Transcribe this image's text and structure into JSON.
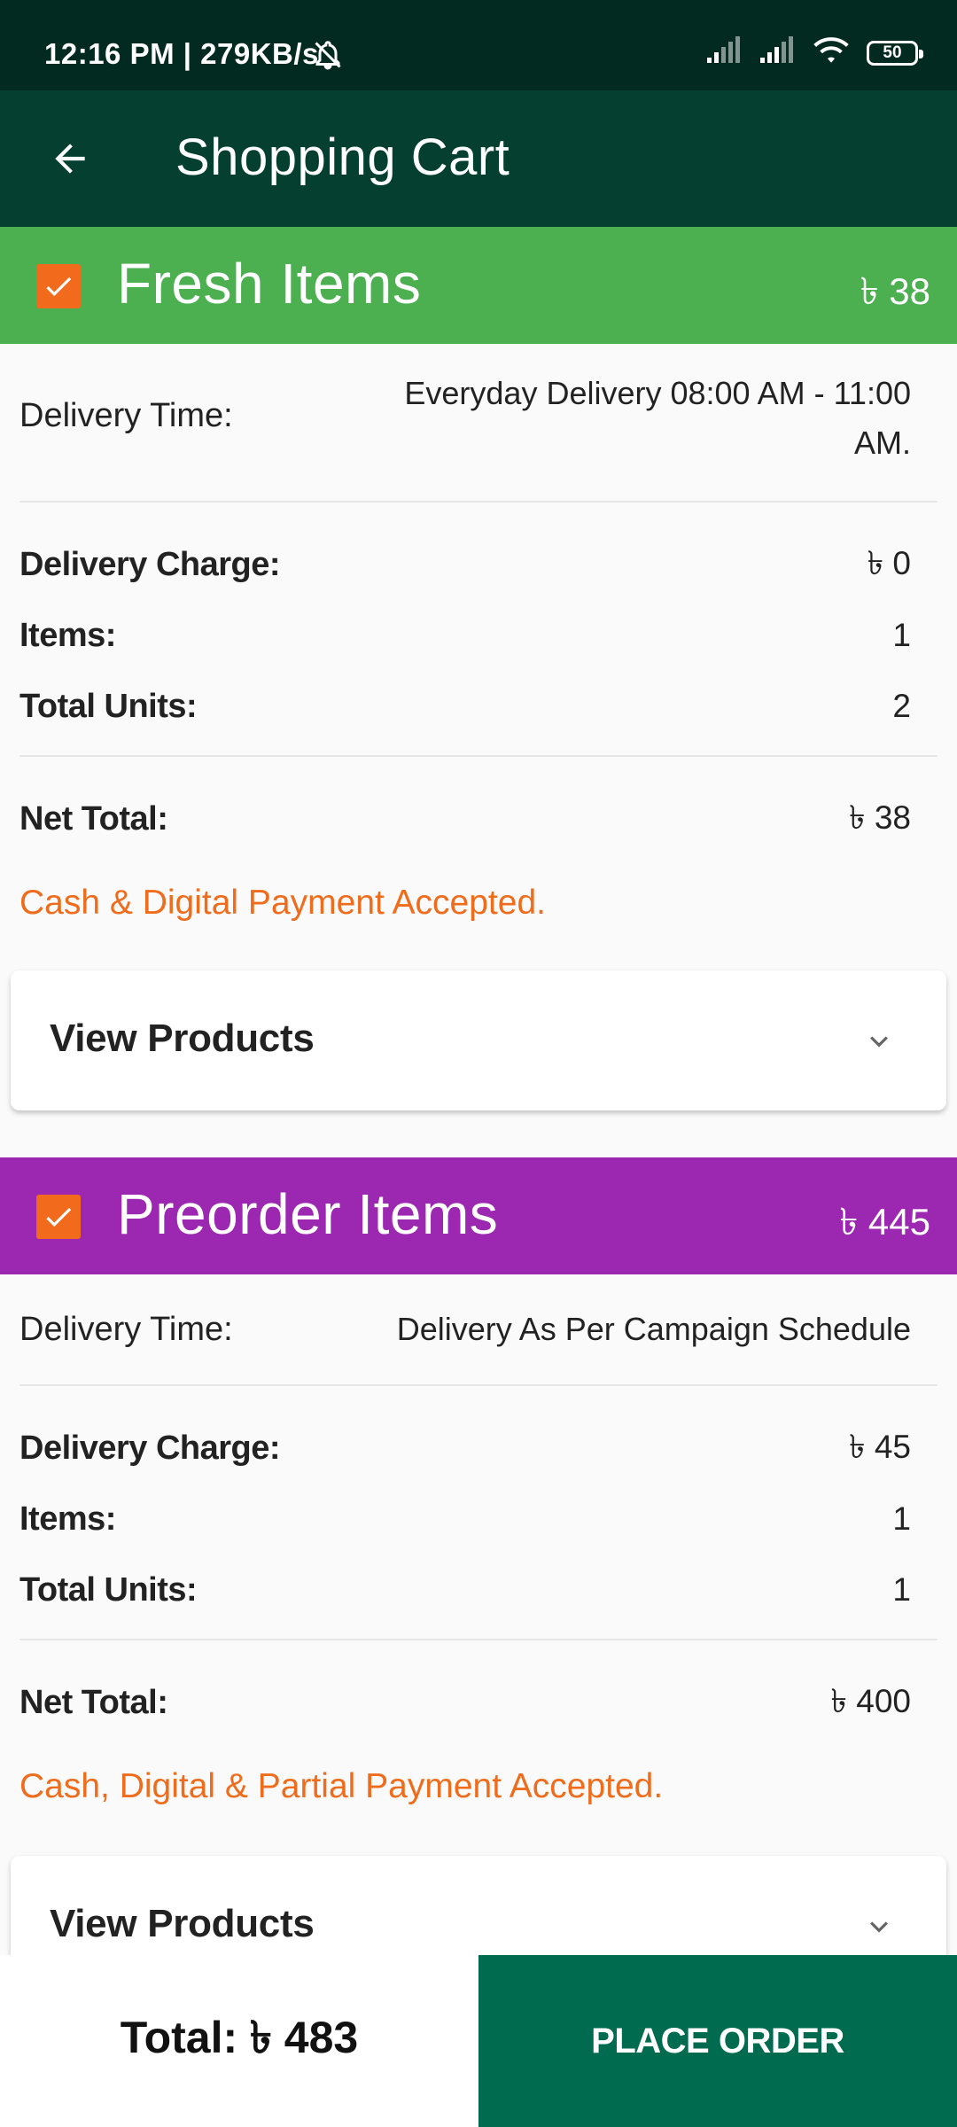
{
  "status_bar": {
    "time": "12:16 PM | 279KB/s",
    "battery": "50"
  },
  "app_bar": {
    "title": "Shopping Cart"
  },
  "sections": [
    {
      "title": "Fresh Items",
      "amount": "৳ 38",
      "header_color": "#4caf50",
      "checked": true,
      "delivery_time_label": "Delivery Time:",
      "delivery_time_value": "Everyday Delivery 08:00 AM - 11:00 AM.",
      "delivery_charge_label": "Delivery Charge:",
      "delivery_charge_value": "৳ 0",
      "items_label": "Items:",
      "items_value": "1",
      "units_label": "Total Units:",
      "units_value": "2",
      "net_total_label": "Net Total:",
      "net_total_value": "৳ 38",
      "payment_note": "Cash & Digital Payment Accepted.",
      "view_products": "View Products"
    },
    {
      "title": "Preorder Items",
      "amount": "৳ 445",
      "header_color": "#9c27b0",
      "checked": true,
      "delivery_time_label": "Delivery Time:",
      "delivery_time_value": "Delivery As Per Campaign Schedule",
      "delivery_charge_label": "Delivery Charge:",
      "delivery_charge_value": "৳ 45",
      "items_label": "Items:",
      "items_value": "1",
      "units_label": "Total Units:",
      "units_value": "1",
      "net_total_label": "Net Total:",
      "net_total_value": "৳ 400",
      "payment_note": "Cash, Digital & Partial Payment Accepted.",
      "view_products": "View Products"
    }
  ],
  "bottom_bar": {
    "total": "Total: ৳ 483",
    "place_order": "PLACE ORDER"
  },
  "colors": {
    "status_bar": "#032a21",
    "app_bar": "#053f30",
    "accent_orange": "#f26b1d",
    "place_order": "#006b4f"
  }
}
